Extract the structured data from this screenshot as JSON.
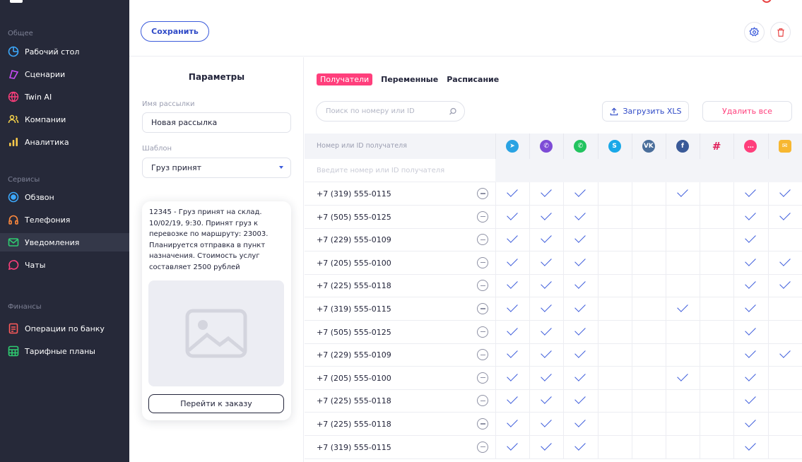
{
  "sidebar": {
    "sections": [
      {
        "title": "Общее",
        "items": [
          {
            "label": "Рабочий стол",
            "icon": "dashboard-icon",
            "color": "#3da9fc"
          },
          {
            "label": "Сценарии",
            "icon": "scenario-icon",
            "color": "#c84cf7"
          },
          {
            "label": "Twin AI",
            "icon": "ai-icon",
            "color": "#ff3f7c"
          },
          {
            "label": "Компании",
            "icon": "companies-icon",
            "color": "#f7d34a"
          },
          {
            "label": "Аналитика",
            "icon": "analytics-icon",
            "color": "#f7c94a"
          }
        ]
      },
      {
        "title": "Сервисы",
        "items": [
          {
            "label": "Обзвон",
            "icon": "call-icon",
            "color": "#3da9fc"
          },
          {
            "label": "Телефония",
            "icon": "headset-icon",
            "color": "#ff8a3d"
          },
          {
            "label": "Уведомления",
            "icon": "mail-icon",
            "color": "#2ecc71"
          },
          {
            "label": "Чаты",
            "icon": "chat-icon",
            "color": "#ff3f7c"
          }
        ]
      },
      {
        "title": "Финансы",
        "items": [
          {
            "label": "Операции по банку",
            "icon": "bank-icon",
            "color": "#ff5a5a"
          },
          {
            "label": "Тарифные планы",
            "icon": "tariff-icon",
            "color": "#2ecc71"
          }
        ]
      }
    ]
  },
  "toolbar": {
    "save_label": "Сохранить"
  },
  "params": {
    "title": "Параметры",
    "name_label": "Имя рассылки",
    "name_value": "Новая рассылка",
    "template_label": "Шаблон",
    "template_value": "Груз принят",
    "preview_text": "12345 - Груз принят на склад. 10/02/19, 9:30. Принят груз к перевозке по маршруту: 23003. Планируется отправка в пункт назначения. Стоимость услуг составляет 2500 рублей",
    "order_button": "Перейти к заказу"
  },
  "recipients": {
    "tabs": [
      "Получатели",
      "Переменные",
      "Расписание"
    ],
    "search_placeholder": "Поиск по номеру или ID",
    "upload_label": "Загрузить XLS",
    "delete_all_label": "Удалить все",
    "column_header": "Номер или ID получателя",
    "filter_placeholder": "Введите номер или ID получателя",
    "channels": [
      {
        "name": "telegram-icon",
        "color": "#2aa3e3",
        "glyph": "➤"
      },
      {
        "name": "viber-icon",
        "color": "#7d4bd6",
        "glyph": "✆"
      },
      {
        "name": "whatsapp-icon",
        "color": "#22c35e",
        "glyph": "✆"
      },
      {
        "name": "skype-icon",
        "color": "#19a8e8",
        "glyph": "S"
      },
      {
        "name": "vk-icon",
        "color": "#4a6e9b",
        "glyph": "VK"
      },
      {
        "name": "facebook-icon",
        "color": "#3a5a98",
        "glyph": "f"
      },
      {
        "name": "slack-icon",
        "color": "#ffffff",
        "glyph": "#"
      },
      {
        "name": "sms-icon",
        "color": "#ff3f7c",
        "glyph": "…"
      },
      {
        "name": "email-icon",
        "color": "#f7b731",
        "glyph": "✉"
      }
    ],
    "rows": [
      {
        "number": "+7 (319) 555-0115",
        "checks": [
          1,
          1,
          1,
          0,
          0,
          1,
          0,
          1,
          1
        ]
      },
      {
        "number": "+7 (505) 555-0125",
        "checks": [
          1,
          1,
          1,
          0,
          0,
          0,
          0,
          1,
          1
        ]
      },
      {
        "number": "+7 (229) 555-0109",
        "checks": [
          1,
          1,
          1,
          0,
          0,
          0,
          0,
          1,
          0
        ]
      },
      {
        "number": "+7 (205) 555-0100",
        "checks": [
          1,
          1,
          1,
          0,
          0,
          0,
          0,
          1,
          1
        ]
      },
      {
        "number": "+7 (225) 555-0118",
        "checks": [
          1,
          1,
          1,
          0,
          0,
          0,
          0,
          1,
          1
        ]
      },
      {
        "number": "+7 (319) 555-0115",
        "checks": [
          1,
          1,
          1,
          0,
          0,
          1,
          0,
          1,
          0
        ]
      },
      {
        "number": "+7 (505) 555-0125",
        "checks": [
          1,
          1,
          1,
          0,
          0,
          0,
          0,
          1,
          0
        ]
      },
      {
        "number": "+7 (229) 555-0109",
        "checks": [
          1,
          1,
          1,
          0,
          0,
          0,
          0,
          1,
          1
        ]
      },
      {
        "number": "+7 (205) 555-0100",
        "checks": [
          1,
          1,
          1,
          0,
          0,
          1,
          0,
          1,
          0
        ]
      },
      {
        "number": "+7 (225) 555-0118",
        "checks": [
          1,
          1,
          1,
          0,
          0,
          0,
          0,
          1,
          0
        ]
      },
      {
        "number": "+7 (225) 555-0118",
        "checks": [
          1,
          1,
          1,
          0,
          0,
          0,
          0,
          1,
          0
        ]
      },
      {
        "number": "+7 (319) 555-0115",
        "checks": [
          1,
          1,
          1,
          0,
          0,
          0,
          0,
          1,
          0
        ]
      }
    ]
  },
  "colors": {
    "accent": "#3b5bdb",
    "pink": "#ff3f7c",
    "sidebar_bg": "#262939"
  }
}
